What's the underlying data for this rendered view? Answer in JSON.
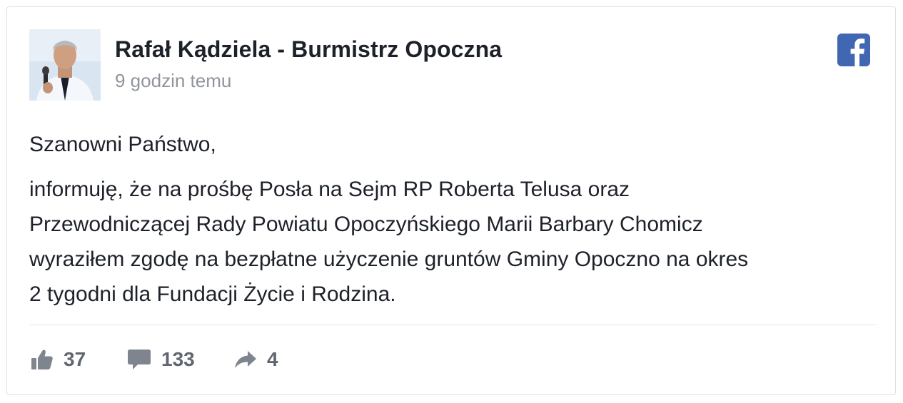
{
  "post": {
    "author": "Rafał Kądziela - Burmistrz Opoczna",
    "time": "9 godzin temu",
    "greeting": "Szanowni Państwo,",
    "paragraph_lines": [
      "informuję, że na prośbę Posła na Sejm RP Roberta Telusa oraz",
      "Przewodniczącej Rady Powiatu Opoczyńskiego Marii Barbary Chomicz",
      "wyraziłem zgodę na bezpłatne użyczenie gruntów Gminy Opoczno na okres",
      "2 tygodni dla Fundacji Życie i Rodzina."
    ]
  },
  "actions": {
    "likes": "37",
    "comments": "133",
    "shares": "4"
  },
  "icons": {
    "logo": "facebook-icon",
    "like": "thumbs-up-icon",
    "comment": "speech-bubble-icon",
    "share": "share-arrow-icon"
  },
  "colors": {
    "brand": "#4267b2",
    "text": "#1d2129",
    "muted": "#90949c",
    "action": "#616770"
  }
}
